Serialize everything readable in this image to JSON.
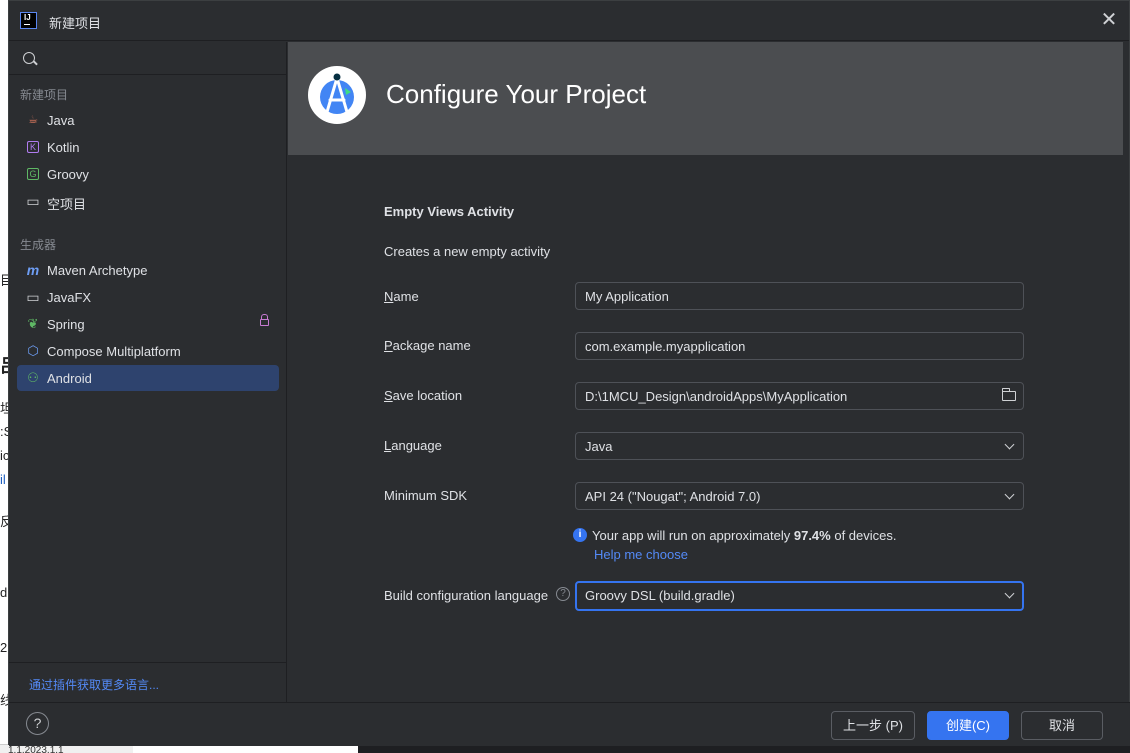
{
  "window": {
    "title": "新建项目",
    "close_glyph": "✕"
  },
  "background": {
    "fragments": [
      "目",
      "",
      "吕",
      "坦",
      ":S",
      "ic",
      "il",
      "",
      "反",
      "",
      "dl",
      "2",
      "线"
    ],
    "bottom_text": "1.1.2023.1.1"
  },
  "sidebar": {
    "search_placeholder": "",
    "groups": [
      {
        "label": "新建项目",
        "items": [
          {
            "label": "Java",
            "icon": "java-icon",
            "icon_glyph": "☕",
            "icon_color": "#e07a5f"
          },
          {
            "label": "Kotlin",
            "icon": "kotlin-icon",
            "icon_glyph": "K",
            "icon_color": "#b07cf0"
          },
          {
            "label": "Groovy",
            "icon": "groovy-icon",
            "icon_glyph": "G",
            "icon_color": "#5fb865"
          },
          {
            "label": "空项目",
            "icon": "empty-project-icon",
            "icon_glyph": "▭",
            "icon_color": "#cfd1d4"
          }
        ]
      },
      {
        "label": "生成器",
        "items": [
          {
            "label": "Maven Archetype",
            "icon": "maven-icon",
            "icon_glyph": "m",
            "icon_color": "#6e9ef5"
          },
          {
            "label": "JavaFX",
            "icon": "javafx-icon",
            "icon_glyph": "▭",
            "icon_color": "#cfd1d4"
          },
          {
            "label": "Spring",
            "icon": "spring-icon",
            "icon_glyph": "❦",
            "icon_color": "#5fb865",
            "locked": true
          },
          {
            "label": "Compose Multiplatform",
            "icon": "compose-icon",
            "icon_glyph": "⬡",
            "icon_color": "#6e9ef5"
          },
          {
            "label": "Android",
            "icon": "android-icon",
            "icon_glyph": "⚇",
            "icon_color": "#5fb865",
            "selected": true
          }
        ]
      }
    ],
    "plugins_link": "通过插件获取更多语言..."
  },
  "header": {
    "title": "Configure Your Project",
    "logo": "android-studio-logo"
  },
  "form": {
    "template_title": "Empty Views Activity",
    "template_desc": "Creates a new empty activity",
    "name": {
      "label_first": "N",
      "label_rest": "ame",
      "value": "My Application"
    },
    "package": {
      "label_first": "P",
      "label_rest": "ackage name",
      "value": "com.example.myapplication"
    },
    "save_location": {
      "label_first": "S",
      "label_rest": "ave location",
      "value": "D:\\1MCU_Design\\androidApps\\MyApplication"
    },
    "language": {
      "label_first": "L",
      "label_rest": "anguage",
      "value": "Java"
    },
    "min_sdk": {
      "label": "Minimum SDK",
      "value": "API 24 (\"Nougat\"; Android 7.0)"
    },
    "info": {
      "prefix": "Your app will run on approximately ",
      "percent": "97.4%",
      "suffix": " of devices.",
      "help_link": "Help me choose",
      "icon_glyph": "i"
    },
    "build_lang": {
      "label": "Build configuration language",
      "help_glyph": "?",
      "value": "Groovy DSL (build.gradle)"
    }
  },
  "footer": {
    "help_glyph": "?",
    "prev_label": "上一步 (P)",
    "create_label": "创建(C)",
    "cancel_label": "取消"
  },
  "colors": {
    "accent": "#3574f0",
    "link": "#548af7",
    "selected_bg": "#2e436e",
    "header_bg": "#4b4d50",
    "panel_bg": "#2b2d30"
  }
}
